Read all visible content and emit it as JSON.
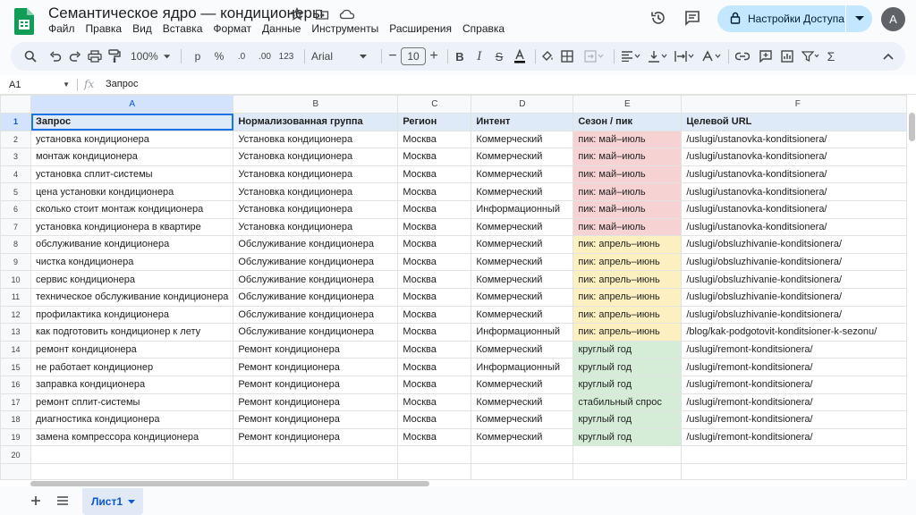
{
  "document": {
    "title": "Семантическое ядро — кондиционеры",
    "menu": [
      "Файл",
      "Правка",
      "Вид",
      "Вставка",
      "Формат",
      "Данные",
      "Инструменты",
      "Расширения",
      "Справка"
    ]
  },
  "share": {
    "label": "Настройки Доступа"
  },
  "user": {
    "avatar_letter": "A"
  },
  "toolbar": {
    "zoom": "100%",
    "currency": "р",
    "percent": "%",
    "dec_less": ".0",
    "dec_more": ".00",
    "number_format": "123",
    "font": "Arial",
    "font_size": "10"
  },
  "formula_bar": {
    "cell_ref": "A1",
    "fx": "fx",
    "value": "Запрос"
  },
  "columns": [
    "A",
    "B",
    "C",
    "D",
    "E",
    "F"
  ],
  "header_row": {
    "num": "1",
    "cells": [
      "Запрос",
      "Нормализованная группа",
      "Регион",
      "Интент",
      "Сезон / пик",
      "Целевой URL"
    ]
  },
  "rows": [
    {
      "num": "2",
      "query": "установка кондиционера",
      "group": "Установка кондиционера",
      "region": "Москва",
      "intent": "Коммерческий",
      "season": "пик: май–июль",
      "url": "/uslugi/ustanovka-konditsionera/"
    },
    {
      "num": "3",
      "query": "монтаж кондиционера",
      "group": "Установка кондиционера",
      "region": "Москва",
      "intent": "Коммерческий",
      "season": "пик: май–июль",
      "url": "/uslugi/ustanovka-konditsionera/"
    },
    {
      "num": "4",
      "query": "установка сплит-системы",
      "group": "Установка кондиционера",
      "region": "Москва",
      "intent": "Коммерческий",
      "season": "пик: май–июль",
      "url": "/uslugi/ustanovka-konditsionera/"
    },
    {
      "num": "5",
      "query": "цена установки кондиционера",
      "group": "Установка кондиционера",
      "region": "Москва",
      "intent": "Коммерческий",
      "season": "пик: май–июль",
      "url": "/uslugi/ustanovka-konditsionera/"
    },
    {
      "num": "6",
      "query": "сколько стоит монтаж кондиционера",
      "group": "Установка кондиционера",
      "region": "Москва",
      "intent": "Информационный",
      "season": "пик: май–июль",
      "url": "/uslugi/ustanovka-konditsionera/"
    },
    {
      "num": "7",
      "query": "установка кондиционера в квартире",
      "group": "Установка кондиционера",
      "region": "Москва",
      "intent": "Коммерческий",
      "season": "пик: май–июль",
      "url": "/uslugi/ustanovka-konditsionera/"
    },
    {
      "num": "8",
      "query": "обслуживание кондиционера",
      "group": "Обслуживание кондиционера",
      "region": "Москва",
      "intent": "Коммерческий",
      "season": "пик: апрель–июнь",
      "url": "/uslugi/obsluzhivanie-konditsionera/"
    },
    {
      "num": "9",
      "query": "чистка кондиционера",
      "group": "Обслуживание кондиционера",
      "region": "Москва",
      "intent": "Коммерческий",
      "season": "пик: апрель–июнь",
      "url": "/uslugi/obsluzhivanie-konditsionera/"
    },
    {
      "num": "10",
      "query": "сервис кондиционера",
      "group": "Обслуживание кондиционера",
      "region": "Москва",
      "intent": "Коммерческий",
      "season": "пик: апрель–июнь",
      "url": "/uslugi/obsluzhivanie-konditsionera/"
    },
    {
      "num": "11",
      "query": "техническое обслуживание кондиционера",
      "group": "Обслуживание кондиционера",
      "region": "Москва",
      "intent": "Коммерческий",
      "season": "пик: апрель–июнь",
      "url": "/uslugi/obsluzhivanie-konditsionera/"
    },
    {
      "num": "12",
      "query": "профилактика кондиционера",
      "group": "Обслуживание кондиционера",
      "region": "Москва",
      "intent": "Коммерческий",
      "season": "пик: апрель–июнь",
      "url": "/uslugi/obsluzhivanie-konditsionera/"
    },
    {
      "num": "13",
      "query": "как подготовить кондиционер к лету",
      "group": "Обслуживание кондиционера",
      "region": "Москва",
      "intent": "Информационный",
      "season": "пик: апрель–июнь",
      "url": "/blog/kak-podgotovit-konditsioner-k-sezonu/"
    },
    {
      "num": "14",
      "query": "ремонт кондиционера",
      "group": "Ремонт кондиционера",
      "region": "Москва",
      "intent": "Коммерческий",
      "season": "круглый год",
      "url": "/uslugi/remont-konditsionera/"
    },
    {
      "num": "15",
      "query": "не работает кондиционер",
      "group": "Ремонт кондиционера",
      "region": "Москва",
      "intent": "Информационный",
      "season": "круглый год",
      "url": "/uslugi/remont-konditsionera/"
    },
    {
      "num": "16",
      "query": "заправка кондиционера",
      "group": "Ремонт кондиционера",
      "region": "Москва",
      "intent": "Коммерческий",
      "season": "круглый год",
      "url": "/uslugi/remont-konditsionera/"
    },
    {
      "num": "17",
      "query": "ремонт сплит-системы",
      "group": "Ремонт кондиционера",
      "region": "Москва",
      "intent": "Коммерческий",
      "season": "стабильный спрос",
      "url": "/uslugi/remont-konditsionera/"
    },
    {
      "num": "18",
      "query": "диагностика кондиционера",
      "group": "Ремонт кондиционера",
      "region": "Москва",
      "intent": "Коммерческий",
      "season": "круглый год",
      "url": "/uslugi/remont-konditsionera/"
    },
    {
      "num": "19",
      "query": "замена компрессора кондиционера",
      "group": "Ремонт кондиционера",
      "region": "Москва",
      "intent": "Коммерческий",
      "season": "круглый год",
      "url": "/uslugi/remont-konditsionera/"
    }
  ],
  "empty_row_num": "20",
  "season_colors": {
    "peak_summer": "#f6d2d2",
    "peak_spring": "#fcefc0",
    "year_round": "#d5ecd6",
    "header": "#deeaf8"
  },
  "sheet_tab": {
    "label": "Лист1"
  }
}
